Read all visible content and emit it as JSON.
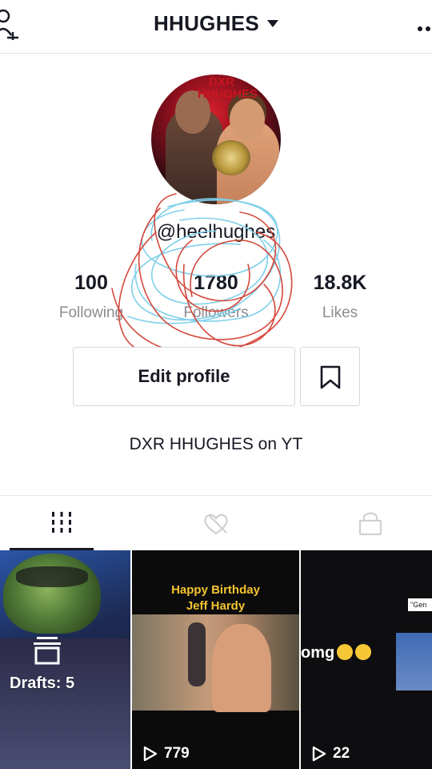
{
  "header": {
    "username": "HHUGHES",
    "add_user_icon": "add-user-icon",
    "more_icon": "more-dots-icon"
  },
  "profile": {
    "handle": "@heelhughes",
    "avatar_watermark": "DXR HHUGHES",
    "stats": {
      "following": {
        "value": "100",
        "label": "Following"
      },
      "followers": {
        "value": "1780",
        "label": "Followers"
      },
      "likes": {
        "value": "18.8K",
        "label": "Likes"
      }
    },
    "edit_profile_label": "Edit profile",
    "bio": "DXR HHUGHES on YT"
  },
  "tabs": [
    {
      "name": "videos",
      "icon": "grid-bars-icon",
      "active": true
    },
    {
      "name": "liked",
      "icon": "heart-hidden-icon",
      "active": false
    },
    {
      "name": "private",
      "icon": "lock-icon",
      "active": false
    }
  ],
  "videos": [
    {
      "type": "drafts",
      "label": "Drafts: 5"
    },
    {
      "caption": "Happy Birthday\nJeff Hardy",
      "views": "779"
    },
    {
      "caption": "omg",
      "overlay": "\"Gen",
      "views": "22"
    }
  ],
  "colors": {
    "text": "#161823",
    "secondary_text": "#8a8b91",
    "border": "#d7d7d9",
    "scribble_red": "#d4483c",
    "scribble_blue": "#7fd0ea",
    "caption_yellow": "#f4c430"
  }
}
